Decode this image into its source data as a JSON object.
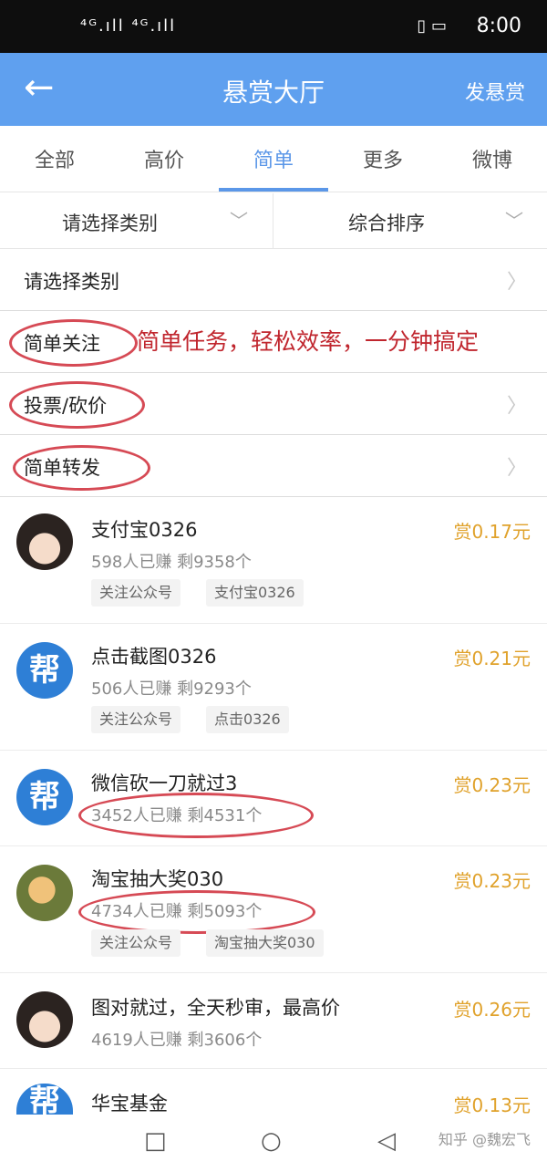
{
  "status_bar": {
    "signal": "⁴ᴳ.ıll ⁴ᴳ.ıll",
    "icons": "◫ ▯ ··· ",
    "right_icons": "▯ ▭",
    "time": "8:00"
  },
  "app_bar": {
    "back_icon": "←",
    "title": "悬赏大厅",
    "action": "发悬赏"
  },
  "tabs": [
    "全部",
    "高价",
    "简单",
    "更多",
    "微博"
  ],
  "active_tab": "简单",
  "filters": {
    "category": "请选择类别",
    "sort": "综合排序",
    "chevron": "﹀"
  },
  "categories": [
    {
      "label": "请选择类别"
    },
    {
      "label": "简单关注"
    },
    {
      "label": "投票/砍价"
    },
    {
      "label": "简单转发"
    }
  ],
  "arrow": "〉",
  "annotation": "简单任务，轻松效率，一分钟搞定",
  "annotation_color": "#c0262e",
  "reward_color": "#e0a22c",
  "accent_color": "#5fa0ef",
  "tasks": [
    {
      "avatar": "girl-avatar",
      "title": "支付宝0326",
      "stats": "598人已赚  剩9358个",
      "reward": "赏0.17元",
      "tags": [
        "关注公众号",
        "支付宝0326"
      ]
    },
    {
      "avatar": "bang-avatar",
      "avatar_text": "帮",
      "title": "点击截图0326",
      "stats": "506人已赚  剩9293个",
      "reward": "赏0.21元",
      "tags": [
        "关注公众号",
        "点击0326"
      ]
    },
    {
      "avatar": "bang-avatar",
      "avatar_text": "帮",
      "title": "微信砍一刀就过3",
      "stats": "3452人已赚  剩4531个",
      "reward": "赏0.23元",
      "tags": []
    },
    {
      "avatar": "duck-avatar",
      "title": "淘宝抽大奖030",
      "stats": "4734人已赚  剩5093个",
      "reward": "赏0.23元",
      "tags": [
        "关注公众号",
        "淘宝抽大奖030"
      ]
    },
    {
      "avatar": "girl-avatar",
      "title": "图对就过，全天秒审，最高价",
      "stats": "4619人已赚  剩3606个",
      "reward": "赏0.26元",
      "tags": []
    },
    {
      "avatar": "bang-avatar",
      "avatar_text": "帮",
      "title": "华宝基金",
      "stats": "",
      "reward": "赏0.13元",
      "tags": []
    }
  ],
  "nav": {
    "recent": "□",
    "home": "○",
    "back": "◁"
  },
  "watermark": "知乎 @魏宏飞"
}
